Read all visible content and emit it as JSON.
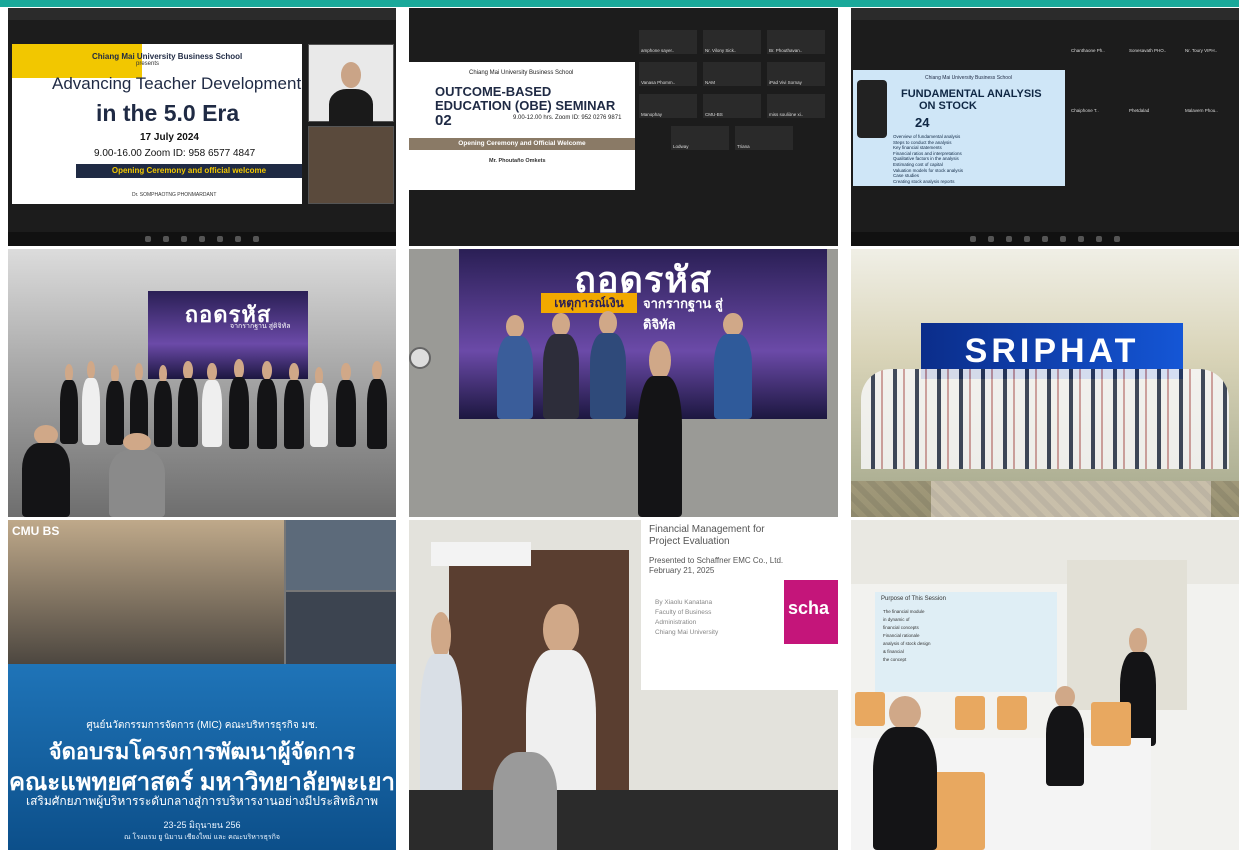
{
  "tiles": {
    "t1": {
      "school": "Chiang Mai University Business School",
      "presents": "presents",
      "title_line1": "Advancing Teacher Development",
      "title_line2": "in the 5.0 Era",
      "date": "17 July 2024",
      "time_zoom": "9.00-16.00   Zoom ID: 958 6577 4847",
      "band": "Opening Ceremony and official welcome",
      "speaker": "Dr. SOMPHAOTNG PHONMARDANT"
    },
    "t2": {
      "school": "Chiang Mai University Business School",
      "title_line1": "OUTCOME-BASED",
      "title_line2": "EDUCATION (OBE) SEMINAR",
      "day": "02",
      "info": "9.00-12.00 hrs. Zoom ID: 952 0276 9871",
      "band": "Opening Ceremony and Official Welcome",
      "speaker": "Mr. Phoutaño Omkets",
      "participants": [
        "amphone sayer..",
        "Nr. Vilony Sick..",
        "Br. Phouthavan..",
        "Vanasa Phomm..",
        "NAM",
        "iPad Vivi Sornay",
        "Manophay",
        "CMU-BS",
        "miss souliòne xi..",
        "Lodway",
        "Triana"
      ]
    },
    "t3": {
      "school": "Chiang Mai University Business School",
      "title_line1": "FUNDAMENTAL ANALYSIS",
      "title_line2": "ON STOCK",
      "day": "24",
      "outline": [
        "Overview of fundamental analysis",
        "Steps to conduct the analysis",
        "Key financial statements",
        "Financial ratios and interpretations",
        "Qualitative factors in the analysis",
        "Estimating cost of capital",
        "Valuation models for stock analysis",
        "Case studies",
        "Creating stock analysis reports"
      ],
      "participants": [
        "Chanthaone Ph..",
        "Sonesavath PHO..",
        "Nr. Toury VIPH..",
        "Chaiphone T..",
        "Phetdalad",
        "Malavern Phou.."
      ]
    },
    "t4": {
      "screen_title": "ถอดรหัส",
      "screen_sub": "จากรากฐาน สู่ดิจิทัล"
    },
    "t5": {
      "screen_title": "ถอดรหัส",
      "screen_stripe": "เหตุการณ์เงิน",
      "screen_sub": "จากรากฐาน สู่ดิจิทัล"
    },
    "t6": {
      "banner": "SRIPHAT"
    },
    "t7": {
      "logo": "CMU BS",
      "line1": "ศูนย์นวัตกรรมการจัดการ (MIC) คณะบริหารธุรกิจ มช.",
      "line2": "จัดอบรมโครงการพัฒนาผู้จัดการ",
      "line3": "คณะแพทยศาสตร์ มหาวิทยาลัยพะเยา",
      "line4": "เสริมศักยภาพผู้บริหารระดับกลางสู่การบริหารงานอย่างมีประสิทธิภาพ",
      "line5": "23-25 มิถุนายน 256",
      "line6": "ณ โรงแรม ยู นิมาน เชียงใหม่ และ คณะบริหารธุรกิจ"
    },
    "t8": {
      "slide_line1": "Financial Management for",
      "slide_line2": "Project Evaluation",
      "slide_line3": "Presented to Schaffner EMC Co., Ltd.",
      "slide_line4": "February 21, 2025",
      "slide_credits": [
        "By Xiaolu Kanatana",
        "Faculty of Business",
        "Administration",
        "Chiang Mai University"
      ],
      "slide_logo": "scha"
    },
    "t9": {
      "slide_title": "Purpose of This Session",
      "slide_points": [
        "The financial module",
        "in dynamic of",
        "financial concepts",
        "Financial rationale",
        "analysis of stock design",
        "& financial",
        "the concept"
      ]
    },
    "colors": {
      "accent": "#1aa99a",
      "brand_yellow": "#f2c700",
      "navy": "#1f2a44",
      "sriphat_blue": "#0b2d8a",
      "banner_blue": "#1f74b8",
      "orange_chair": "#e8a860"
    }
  }
}
